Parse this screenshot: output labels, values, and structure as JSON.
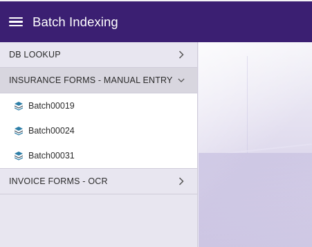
{
  "app_bar": {
    "title": "Batch Indexing",
    "menu_icon": "hamburger-menu-icon",
    "background": "#3b1f72"
  },
  "sections": [
    {
      "label": "DB LOOKUP",
      "expanded": false,
      "chevron": "chevron-right-icon"
    },
    {
      "label": "INSURANCE FORMS - MANUAL ENTRY",
      "expanded": true,
      "chevron": "chevron-down-icon",
      "items": [
        {
          "label": "Batch00019",
          "icon": "layers-icon"
        },
        {
          "label": "Batch00024",
          "icon": "layers-icon"
        },
        {
          "label": "Batch00031",
          "icon": "layers-icon"
        }
      ]
    },
    {
      "label": "INVOICE FORMS - OCR",
      "expanded": false,
      "chevron": "chevron-right-icon"
    }
  ],
  "colors": {
    "accent": "#3b1f72",
    "layers_icon": "#2e7fa8"
  }
}
